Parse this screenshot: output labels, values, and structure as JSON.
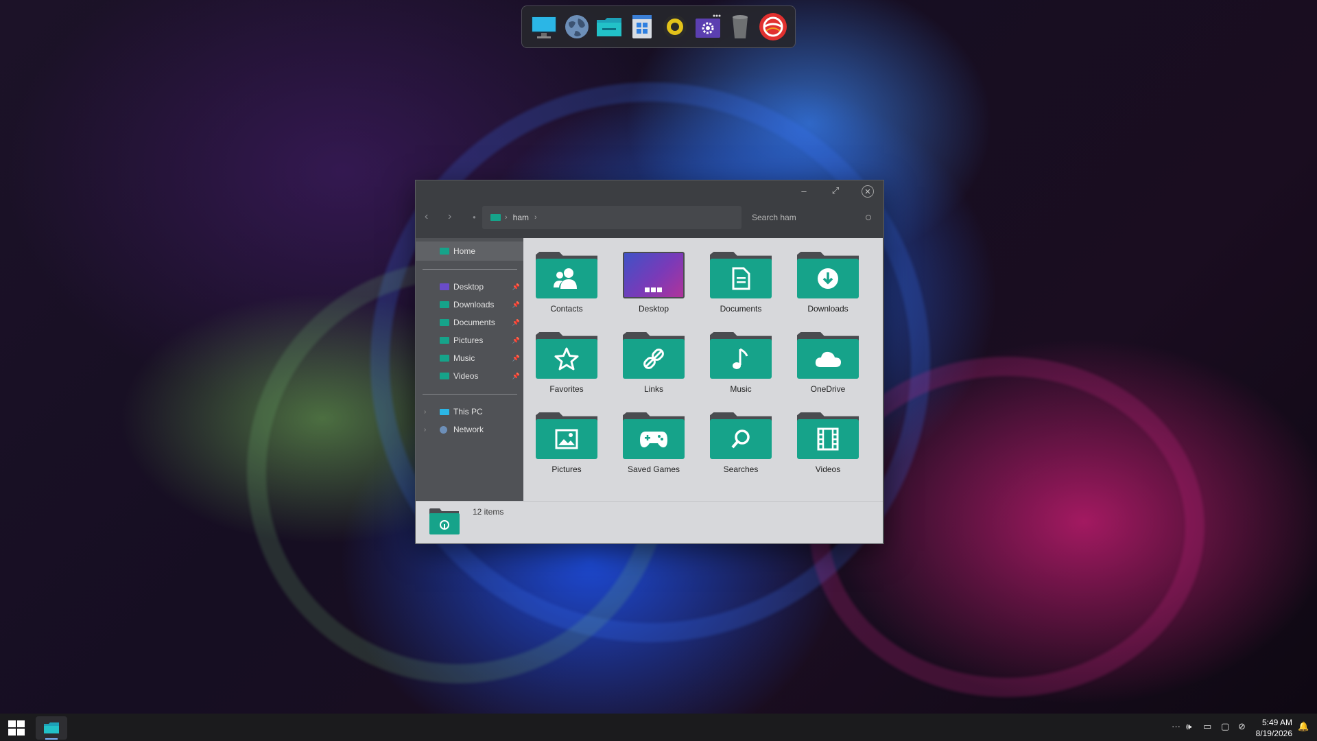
{
  "dock": {
    "items": [
      {
        "name": "monitor-icon"
      },
      {
        "name": "globe-icon"
      },
      {
        "name": "file-explorer-icon"
      },
      {
        "name": "windows-store-icon"
      },
      {
        "name": "speaker-icon"
      },
      {
        "name": "settings-icon"
      },
      {
        "name": "recycle-bin-icon"
      },
      {
        "name": "app-logo-icon"
      }
    ]
  },
  "explorer": {
    "controls": {
      "minimize": "–",
      "maximize": "⤢",
      "close": "✕"
    },
    "address": {
      "path_label": "ham"
    },
    "search": {
      "placeholder": "Search ham"
    },
    "sidebar": {
      "home": "Home",
      "quick_access": [
        "Desktop",
        "Downloads",
        "Documents",
        "Pictures",
        "Music",
        "Videos"
      ],
      "this_pc": "This PC",
      "network": "Network"
    },
    "folders": [
      {
        "label": "Contacts",
        "icon": "contacts-icon"
      },
      {
        "label": "Desktop",
        "icon": "desktop-icon"
      },
      {
        "label": "Documents",
        "icon": "document-icon"
      },
      {
        "label": "Downloads",
        "icon": "download-icon"
      },
      {
        "label": "Favorites",
        "icon": "star-icon"
      },
      {
        "label": "Links",
        "icon": "link-icon"
      },
      {
        "label": "Music",
        "icon": "music-note-icon"
      },
      {
        "label": "OneDrive",
        "icon": "cloud-icon"
      },
      {
        "label": "Pictures",
        "icon": "image-icon"
      },
      {
        "label": "Saved Games",
        "icon": "gamepad-icon"
      },
      {
        "label": "Searches",
        "icon": "search-icon"
      },
      {
        "label": "Videos",
        "icon": "film-icon"
      }
    ],
    "status": {
      "item_count": "12 items"
    }
  },
  "taskbar": {
    "clock": {
      "time": "5:49 AM",
      "date": "8/19/2026"
    }
  },
  "colors": {
    "accent": "#16a38a",
    "window_bg": "#3c3e42",
    "sidebar_bg": "#505256",
    "content_bg": "#d7d8db",
    "taskbar_bg": "#1b1b1d"
  }
}
